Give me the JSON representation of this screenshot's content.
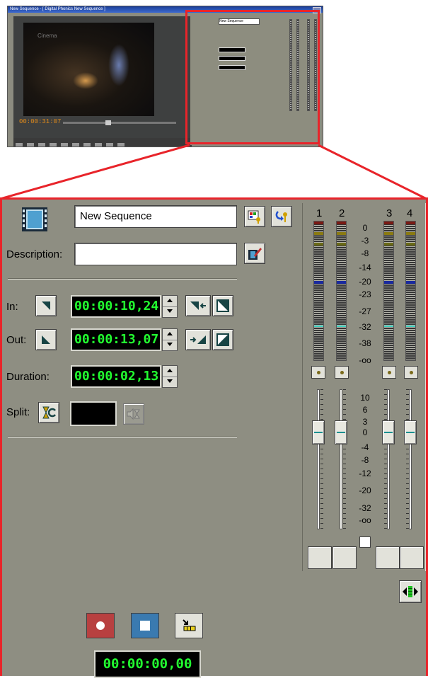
{
  "thumbnail": {
    "window_title": "New Sequence - [ Digital Phonics New Sequence ]",
    "video_overlay": "Cinema",
    "timecode": "00:00:31:07",
    "mini_name": "New Sequence"
  },
  "panel": {
    "name_value": "New Sequence",
    "description_label": "Description:",
    "description_value": "",
    "in_label": "In:",
    "in_timecode": "00:00:10,24",
    "out_label": "Out:",
    "out_timecode": "00:00:13,07",
    "duration_label": "Duration:",
    "duration_timecode": "00:00:02,13",
    "split_label": "Split:",
    "record_timecode": "00:00:00,00"
  },
  "mixer": {
    "channels": [
      "1",
      "2",
      "3",
      "4"
    ],
    "meter_scale": [
      "0",
      "-3",
      "-8",
      "-14",
      "-20",
      "-23",
      "-27",
      "-32",
      "-38",
      "-oo"
    ],
    "fader_scale": [
      "10",
      "6",
      "3",
      "0",
      "-4",
      "-8",
      "-12",
      "-20",
      "-32",
      "-oo"
    ]
  },
  "colors": {
    "highlight": "#e8242a",
    "panel_bg": "#8e8e82",
    "timecode_fg": "#22ff30",
    "record": "#b83a3a",
    "stop": "#3a78a8"
  }
}
